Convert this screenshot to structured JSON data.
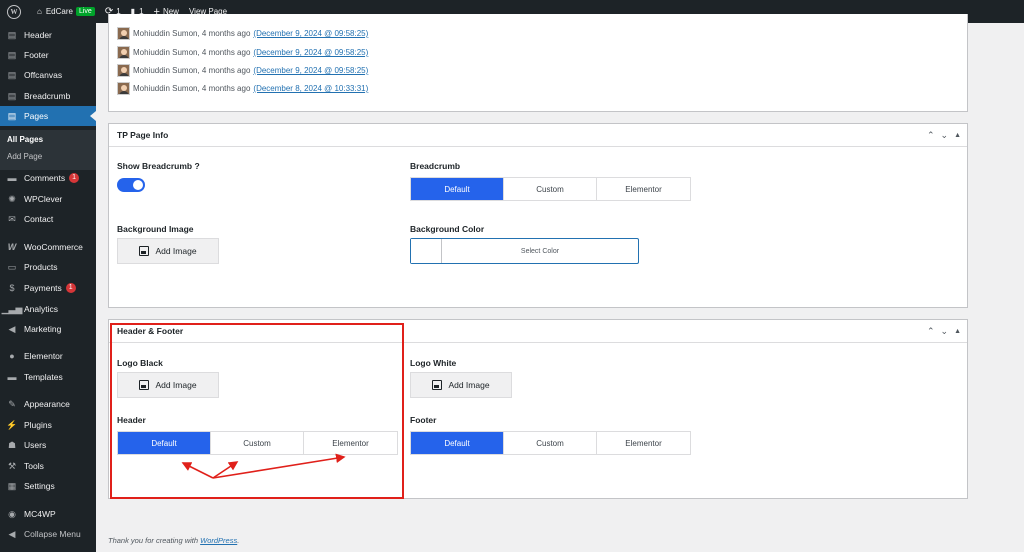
{
  "adminbar": {
    "site_name": "EdCare",
    "live_label": "Live",
    "updates_count": "1",
    "comments_count": "1",
    "new_label": "New",
    "view_page_label": "View Page"
  },
  "sidebar": {
    "items": [
      {
        "label": "Header",
        "icon": "page-icon"
      },
      {
        "label": "Footer",
        "icon": "page-icon"
      },
      {
        "label": "Offcanvas",
        "icon": "page-icon"
      },
      {
        "label": "Breadcrumb",
        "icon": "page-icon"
      },
      {
        "label": "Pages",
        "icon": "pages-icon"
      },
      {
        "label": "Comments",
        "icon": "comment-icon",
        "count": "1"
      },
      {
        "label": "WPClever",
        "icon": "wpclever-icon"
      },
      {
        "label": "Contact",
        "icon": "mail-icon"
      },
      {
        "label": "WooCommerce",
        "icon": "woo-icon"
      },
      {
        "label": "Products",
        "icon": "archive-icon"
      },
      {
        "label": "Payments",
        "icon": "dollar-icon",
        "count": "1"
      },
      {
        "label": "Analytics",
        "icon": "bar-chart-icon"
      },
      {
        "label": "Marketing",
        "icon": "megaphone-icon"
      },
      {
        "label": "Elementor",
        "icon": "elementor-icon"
      },
      {
        "label": "Templates",
        "icon": "folder-icon"
      },
      {
        "label": "Appearance",
        "icon": "brush-icon"
      },
      {
        "label": "Plugins",
        "icon": "plugin-icon"
      },
      {
        "label": "Users",
        "icon": "users-icon"
      },
      {
        "label": "Tools",
        "icon": "wrench-icon"
      },
      {
        "label": "Settings",
        "icon": "settings-icon"
      },
      {
        "label": "MC4WP",
        "icon": "mc4wp-icon"
      },
      {
        "label": "Collapse Menu",
        "icon": "collapse-icon"
      }
    ],
    "pages_submenu": [
      "All Pages",
      "Add Page"
    ]
  },
  "revisions": [
    {
      "author": "Mohiuddin Sumon, 4 months ago",
      "date": "(December 9, 2024 @ 09:58:25)"
    },
    {
      "author": "Mohiuddin Sumon, 4 months ago",
      "date": "(December 9, 2024 @ 09:58:25)"
    },
    {
      "author": "Mohiuddin Sumon, 4 months ago",
      "date": "(December 9, 2024 @ 09:58:25)"
    },
    {
      "author": "Mohiuddin Sumon, 4 months ago",
      "date": "(December 8, 2024 @ 10:33:31)"
    }
  ],
  "page_info": {
    "title": "TP Page Info",
    "show_breadcrumb_label": "Show Breadcrumb ?",
    "show_breadcrumb_on": true,
    "breadcrumb_label": "Breadcrumb",
    "breadcrumb_options": [
      "Default",
      "Custom",
      "Elementor"
    ],
    "breadcrumb_selected": "Default",
    "bg_image_label": "Background Image",
    "add_image_label": "Add Image",
    "bg_color_label": "Background Color",
    "select_color_label": "Select Color"
  },
  "header_footer": {
    "title": "Header & Footer",
    "logo_black_label": "Logo Black",
    "logo_white_label": "Logo White",
    "add_image_label": "Add Image",
    "header_label": "Header",
    "header_options": [
      "Default",
      "Custom",
      "Elementor"
    ],
    "header_selected": "Default",
    "footer_label": "Footer",
    "footer_options": [
      "Default",
      "Custom",
      "Elementor"
    ],
    "footer_selected": "Default"
  },
  "footer": {
    "prefix": "Thank you for creating with ",
    "link": "WordPress",
    "suffix": "."
  },
  "colors": {
    "admin_dark": "#1d2327",
    "wp_blue": "#2271b1",
    "selected_blue": "#2563eb",
    "annotation_red": "#e0201a"
  }
}
